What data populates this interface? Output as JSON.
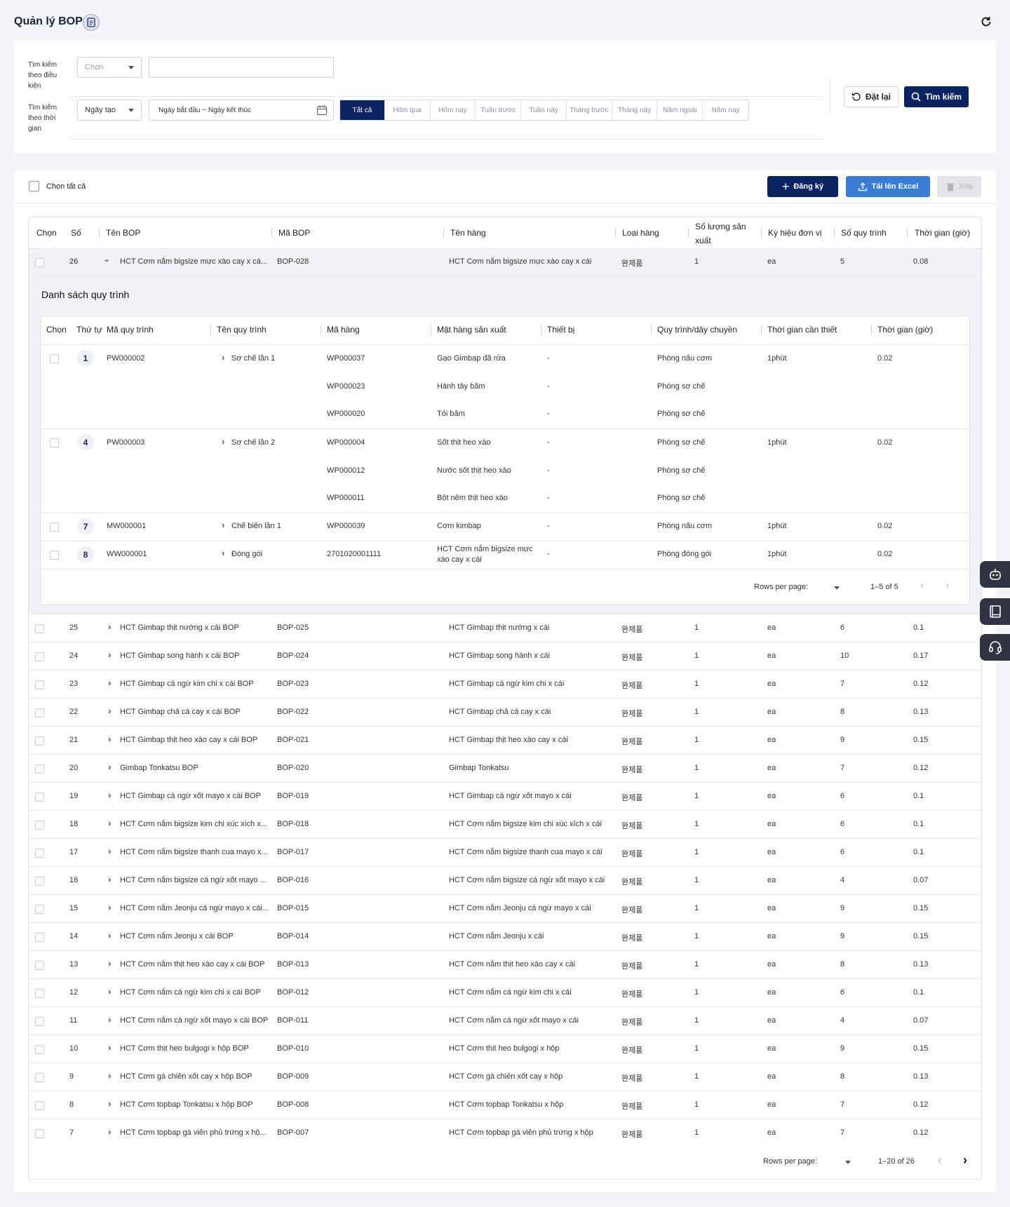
{
  "header": {
    "title": "Quản lý BOP"
  },
  "search": {
    "label_condition": "Tìm kiếm theo điều kiện",
    "label_time": "Tìm kiếm theo thời gian",
    "condition_select": "Chọn",
    "time_select": "Ngày tạo",
    "date_range_placeholder": "Ngày bắt đầu ~ Ngày kết thúc",
    "periods": [
      "Tất cả",
      "Hôm qua",
      "Hôm nay",
      "Tuần trước",
      "Tuần này",
      "Tháng trước",
      "Tháng này",
      "Năm ngoái",
      "Năm nay"
    ],
    "reset_label": "Đặt lại",
    "search_label": "Tìm kiếm"
  },
  "toolbar": {
    "select_all": "Chọn tất cả",
    "register": "Đăng ký",
    "upload_excel": "Tải lên Excel",
    "delete": "Xóa"
  },
  "table": {
    "columns": [
      "Chọn",
      "Số",
      "Tên BOP",
      "Mã BOP",
      "Tên hàng",
      "Loại hàng",
      "Số lượng sản xuất",
      "Ký hiệu đơn vị",
      "Số quy trình",
      "Thời gian (giờ)"
    ],
    "expanded_row": {
      "no": "26",
      "name": "HCT Cơm nắm bigsize mực xào cay x cá...",
      "code": "BOP-028",
      "item": "HCT Cơm nắm bigsize mực xào cay x cái",
      "type": "완제품",
      "qty": "1",
      "unit": "ea",
      "procs": "5",
      "time": "0.08"
    },
    "rows": [
      {
        "no": "25",
        "name": "HCT Gimbap thịt nướng x cái BOP",
        "code": "BOP-025",
        "item": "HCT Gimbap thịt nướng x cái",
        "type": "완제품",
        "qty": "1",
        "unit": "ea",
        "procs": "6",
        "time": "0.1"
      },
      {
        "no": "24",
        "name": "HCT Gimbap song hành x cái BOP",
        "code": "BOP-024",
        "item": "HCT Gimbap song hành x cái",
        "type": "완제품",
        "qty": "1",
        "unit": "ea",
        "procs": "10",
        "time": "0.17"
      },
      {
        "no": "23",
        "name": "HCT Gimbap cá ngừ kim chi x cái BOP",
        "code": "BOP-023",
        "item": "HCT Gimbap cá ngừ kim chi x cái",
        "type": "완제품",
        "qty": "1",
        "unit": "ea",
        "procs": "7",
        "time": "0.12"
      },
      {
        "no": "22",
        "name": "HCT Gimbap chả cá cay x cái BOP",
        "code": "BOP-022",
        "item": "HCT Gimbap chả cá cay x cái",
        "type": "완제품",
        "qty": "1",
        "unit": "ea",
        "procs": "8",
        "time": "0.13"
      },
      {
        "no": "21",
        "name": "HCT Gimbap thịt heo xào cay x cái BOP",
        "code": "BOP-021",
        "item": "HCT Gimbap thịt heo xào cay x cái",
        "type": "완제품",
        "qty": "1",
        "unit": "ea",
        "procs": "9",
        "time": "0.15"
      },
      {
        "no": "20",
        "name": "Gimbap Tonkatsu BOP",
        "code": "BOP-020",
        "item": "Gimbap Tonkatsu",
        "type": "완제품",
        "qty": "1",
        "unit": "ea",
        "procs": "7",
        "time": "0.12"
      },
      {
        "no": "19",
        "name": "HCT Gimbap cá ngừ xốt mayo x cái BOP",
        "code": "BOP-019",
        "item": "HCT Gimbap cá ngừ xốt mayo x cái",
        "type": "완제품",
        "qty": "1",
        "unit": "ea",
        "procs": "6",
        "time": "0.1"
      },
      {
        "no": "18",
        "name": "HCT Cơm nắm bigsize kim chi xúc xích x...",
        "code": "BOP-018",
        "item": "HCT Cơm nắm bigsize kim chi xúc xích x cái",
        "type": "완제품",
        "qty": "1",
        "unit": "ea",
        "procs": "6",
        "time": "0.1"
      },
      {
        "no": "17",
        "name": "HCT Cơm nắm bigsize thanh cua mayo x...",
        "code": "BOP-017",
        "item": "HCT Cơm nắm bigsize thanh cua mayo x cái",
        "type": "완제품",
        "qty": "1",
        "unit": "ea",
        "procs": "6",
        "time": "0.1"
      },
      {
        "no": "16",
        "name": "HCT Cơm nắm bigsize cá ngừ xốt mayo ...",
        "code": "BOP-016",
        "item": "HCT Cơm nắm bigsize cá ngừ xốt mayo x cái",
        "type": "완제품",
        "qty": "1",
        "unit": "ea",
        "procs": "4",
        "time": "0.07"
      },
      {
        "no": "15",
        "name": "HCT Cơm nắm Jeonju cá ngừ mayo x cái...",
        "code": "BOP-015",
        "item": "HCT Cơm nắm Jeonju cá ngừ mayo x cái",
        "type": "완제품",
        "qty": "1",
        "unit": "ea",
        "procs": "9",
        "time": "0.15"
      },
      {
        "no": "14",
        "name": "HCT Cơm nắm Jeonju x cái BOP",
        "code": "BOP-014",
        "item": "HCT Cơm nắm Jeonju x cái",
        "type": "완제품",
        "qty": "1",
        "unit": "ea",
        "procs": "9",
        "time": "0.15"
      },
      {
        "no": "13",
        "name": "HCT Cơm nắm thịt heo xào cay x cái BOP",
        "code": "BOP-013",
        "item": "HCT Cơm nắm thịt heo xào cay x cái",
        "type": "완제품",
        "qty": "1",
        "unit": "ea",
        "procs": "8",
        "time": "0.13"
      },
      {
        "no": "12",
        "name": "HCT Cơm nắm cá ngừ kim chi x cái BOP",
        "code": "BOP-012",
        "item": "HCT Cơm nắm cá ngừ kim chi x cái",
        "type": "완제품",
        "qty": "1",
        "unit": "ea",
        "procs": "6",
        "time": "0.1"
      },
      {
        "no": "11",
        "name": "HCT Cơm nắm cá ngừ xốt mayo x cái BOP",
        "code": "BOP-011",
        "item": "HCT Cơm nắm cá ngừ xốt mayo x cái",
        "type": "완제품",
        "qty": "1",
        "unit": "ea",
        "procs": "4",
        "time": "0.07"
      },
      {
        "no": "10",
        "name": "HCT Cơm thịt heo bulgogi x hộp BOP",
        "code": "BOP-010",
        "item": "HCT Cơm thịt heo bulgogi x hộp",
        "type": "완제품",
        "qty": "1",
        "unit": "ea",
        "procs": "9",
        "time": "0.15"
      },
      {
        "no": "9",
        "name": "HCT Cơm gà chiên xốt cay x hộp BOP",
        "code": "BOP-009",
        "item": "HCT Cơm gà chiên xốt cay x hộp",
        "type": "완제품",
        "qty": "1",
        "unit": "ea",
        "procs": "8",
        "time": "0.13"
      },
      {
        "no": "8",
        "name": "HCT Cơm topbap Tonkatsu x hộp BOP",
        "code": "BOP-008",
        "item": "HCT Cơm topbap Tonkatsu x hộp",
        "type": "완제품",
        "qty": "1",
        "unit": "ea",
        "procs": "7",
        "time": "0.12"
      },
      {
        "no": "7",
        "name": "HCT Cơm topbap gà viên phủ trứng x hộ...",
        "code": "BOP-007",
        "item": "HCT Cơm topbap gà viên phủ trứng x hộp",
        "type": "완제품",
        "qty": "1",
        "unit": "ea",
        "procs": "7",
        "time": "0.12"
      }
    ],
    "pagination": {
      "rows_label": "Rows per page:",
      "range": "1–20 of 26"
    }
  },
  "process": {
    "title": "Danh sách quy trình",
    "columns": [
      "Chọn",
      "Thứ tự",
      "Mã quy trình",
      "Tên quy trình",
      "Mã hàng",
      "Mặt hàng sản xuất",
      "Thiết bị",
      "Quy trình/dây chuyền",
      "Thời gian cần thiết",
      "Thời gian (giờ)"
    ],
    "groups": [
      {
        "order": "1",
        "code": "PW000002",
        "name": "Sơ chế lần 1",
        "need": "1phút",
        "hours": "0.02",
        "items": [
          {
            "code": "WP000037",
            "item": "Gạo Gimbap đã rửa",
            "equip": "-",
            "line": "Phòng nấu cơm"
          },
          {
            "code": "WP000023",
            "item": "Hành tây băm",
            "equip": "-",
            "line": "Phòng sơ chế"
          },
          {
            "code": "WP000020",
            "item": "Tỏi băm",
            "equip": "-",
            "line": "Phòng sơ chế"
          }
        ]
      },
      {
        "order": "4",
        "code": "PW000003",
        "name": "Sơ chế lần 2",
        "need": "1phút",
        "hours": "0.02",
        "items": [
          {
            "code": "WP000004",
            "item": "Sốt thịt heo xào",
            "equip": "-",
            "line": "Phòng sơ chế"
          },
          {
            "code": "WP000012",
            "item": "Nước sốt thịt heo xào",
            "equip": "-",
            "line": "Phòng sơ chế"
          },
          {
            "code": "WP000011",
            "item": "Bột nêm thịt heo xào",
            "equip": "-",
            "line": "Phòng sơ chế"
          }
        ]
      },
      {
        "order": "7",
        "code": "MW000001",
        "name": "Chế biến lần 1",
        "need": "1phút",
        "hours": "0.02",
        "items": [
          {
            "code": "WP000039",
            "item": "Cơm kimbap",
            "equip": "-",
            "line": "Phòng nấu cơm"
          }
        ]
      },
      {
        "order": "8",
        "code": "WW000001",
        "name": "Đóng gói",
        "need": "1phút",
        "hours": "0.02",
        "items": [
          {
            "code": "2701020001111",
            "item": "HCT Cơm nắm bigsize mực xào cay x cái",
            "equip": "-",
            "line": "Phòng đóng gói"
          }
        ]
      }
    ],
    "pagination": {
      "rows_label": "Rows per page:",
      "range": "1–5 of 5"
    }
  },
  "side_icons": [
    "robot-icon",
    "book-icon",
    "headset-icon"
  ]
}
